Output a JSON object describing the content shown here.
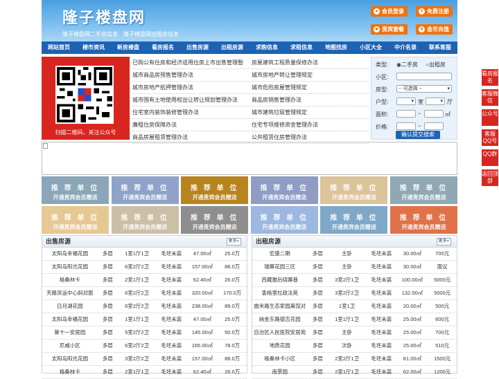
{
  "header": {
    "logo": "隆子楼盘网",
    "slogan": "隆子楼盘网二手房信息　隆子楼盘网出租房信息",
    "buttons": [
      {
        "label": "会员登录",
        "icon": "user-icon"
      },
      {
        "label": "免费注册",
        "icon": "plus-icon"
      },
      {
        "label": "贵宾套餐",
        "icon": "gift-icon"
      },
      {
        "label": "金币充值",
        "icon": "coin-icon"
      }
    ]
  },
  "nav": [
    "网站首页",
    "楼市资讯",
    "新房楼盘",
    "看房报名",
    "出售房源",
    "出租房源",
    "求购信息",
    "求租信息",
    "地图找房",
    "小区大全",
    "中介名录",
    "联系客服"
  ],
  "qr_caption": "扫描二维码，关注公众号",
  "news_left": [
    "已购公有住房和经济适用住房上市出售管理暂",
    "城市商品房预售管理办法",
    "城市房地产抵押管理办法",
    "城市国有土地使用权出让转让规划管理办法",
    "住宅室内装饰装修管理办法",
    "廉租住房保障办法",
    "商品房屋租赁管理办法"
  ],
  "news_right": [
    "房屋建筑工程质量保修办法",
    "城市房地产转让管理规定",
    "城市危险房屋管理规定",
    "商品房销售管理办法",
    "城市建筑垃圾管理规定",
    "住宅专项维修资金管理办法",
    "公共租赁住房管理办法"
  ],
  "search": {
    "type_label": "类型:",
    "opt1": "二手房",
    "opt2": "出租房",
    "area_label": "小区:",
    "style_label": "房型:",
    "style_value": "-- 可选择 --",
    "layout_label": "户型:",
    "room": "室",
    "hall": "厅",
    "size_label": "面积:",
    "sqm": "㎡",
    "price_label": "价格:",
    "tilde": "~",
    "submit": "确认提交搜索"
  },
  "ad": {
    "line1": "推 荐 单 位",
    "line2": "开通贵宾会员赠送"
  },
  "ad_colors": [
    "#8aa6b8",
    "#8fa3c8",
    "#b8841e",
    "#8f9cc4",
    "#dcc39a",
    "#8fa8b4",
    "#e6c892",
    "#cbbfa8",
    "#8e8e8e",
    "#9cb8e0",
    "#7fa8c8",
    "#e0724a"
  ],
  "sale": {
    "title": "出售房源",
    "more": "更多»",
    "rows": [
      [
        "太阳岛幸福花园",
        "多层",
        "1室1厅1卫",
        "毛坯未装",
        "47.00㎡",
        "25.0万"
      ],
      [
        "太阳岛阳光花园",
        "多层",
        "6室2厅2卫",
        "毛坯未装",
        "157.00㎡",
        "88.0万"
      ],
      [
        "格桑林卡",
        "多层",
        "2室1厅1卫",
        "毛坯未装",
        "62.40㎡",
        "26.0万"
      ],
      [
        "天路货运中心斜对面",
        "多层",
        "6室2厅2卫",
        "毛坯未装",
        "320.00㎡",
        "170.0万"
      ],
      [
        "日月湖花园",
        "多层",
        "6室2厅2卫",
        "毛坯未装",
        "238.00㎡",
        "89.0万"
      ],
      [
        "太阳岛幸福花园",
        "多层",
        "1室1厅1卫",
        "毛坯未装",
        "47.00㎡",
        "25.0万"
      ],
      [
        "第十一安居园",
        "多层",
        "5室2厅2卫",
        "毛坯未装",
        "145.00㎡",
        "50.0万"
      ],
      [
        "尼威小区",
        "多层",
        "6室2厅2卫",
        "毛坯未装",
        "165.00㎡",
        "78.0万"
      ],
      [
        "太阳岛阳光花园",
        "多层",
        "3室2厅2卫",
        "毛坯未装",
        "157.00㎡",
        "88.0万"
      ],
      [
        "格桑林卡",
        "多层",
        "2室1厅1卫",
        "毛坯未装",
        "62.40㎡",
        "26.0万"
      ]
    ]
  },
  "rent": {
    "title": "出租房源",
    "more": "更多»",
    "rows": [
      [
        "宏盛二期",
        "多层",
        "主卧",
        "毛坯未装",
        "30.00㎡",
        "700元"
      ],
      [
        "瑞赛花园三区",
        "多层",
        "主卧",
        "毛坯未装",
        "30.00㎡",
        "面议"
      ],
      [
        "西藏雅后绕赛巷",
        "多层",
        "3室2厅1卫",
        "毛坯未装",
        "100.00㎡",
        "5000元"
      ],
      [
        "香格里拉政法苑",
        "多层",
        "3室2厅2卫",
        "毛坯未装",
        "132.00㎡",
        "5000元"
      ],
      [
        "曲米路生态家园离馆对",
        "多层",
        "1室1卫",
        "毛坯未装",
        "20.00㎡",
        "500元"
      ],
      [
        "纳金东路德吉花园",
        "多层",
        "1室1厅1卫",
        "毛坯未装",
        "25.00㎡",
        "600元"
      ],
      [
        "自治区人民医院安居苑",
        "多层",
        "主卧",
        "毛坯未装",
        "25.00㎡",
        "700元"
      ],
      [
        "地质花园",
        "多层",
        "次卧",
        "毛坯未装",
        "25.00㎡",
        "510元"
      ],
      [
        "格桑林卡小区",
        "多层",
        "2室2厅1卫",
        "毛坯未装",
        "81.00㎡",
        "1500元"
      ],
      [
        "南景园",
        "多层",
        "2室1厅1卫",
        "毛坯未装",
        "62.00㎡",
        "1200元"
      ]
    ]
  },
  "side": [
    {
      "label": "看房报名"
    },
    {
      "label": "客服微信"
    },
    {
      "label": "公众号"
    },
    {
      "label": "客服QQ号"
    },
    {
      "label": "QQ群"
    },
    {
      "label": "返回顶部"
    }
  ]
}
